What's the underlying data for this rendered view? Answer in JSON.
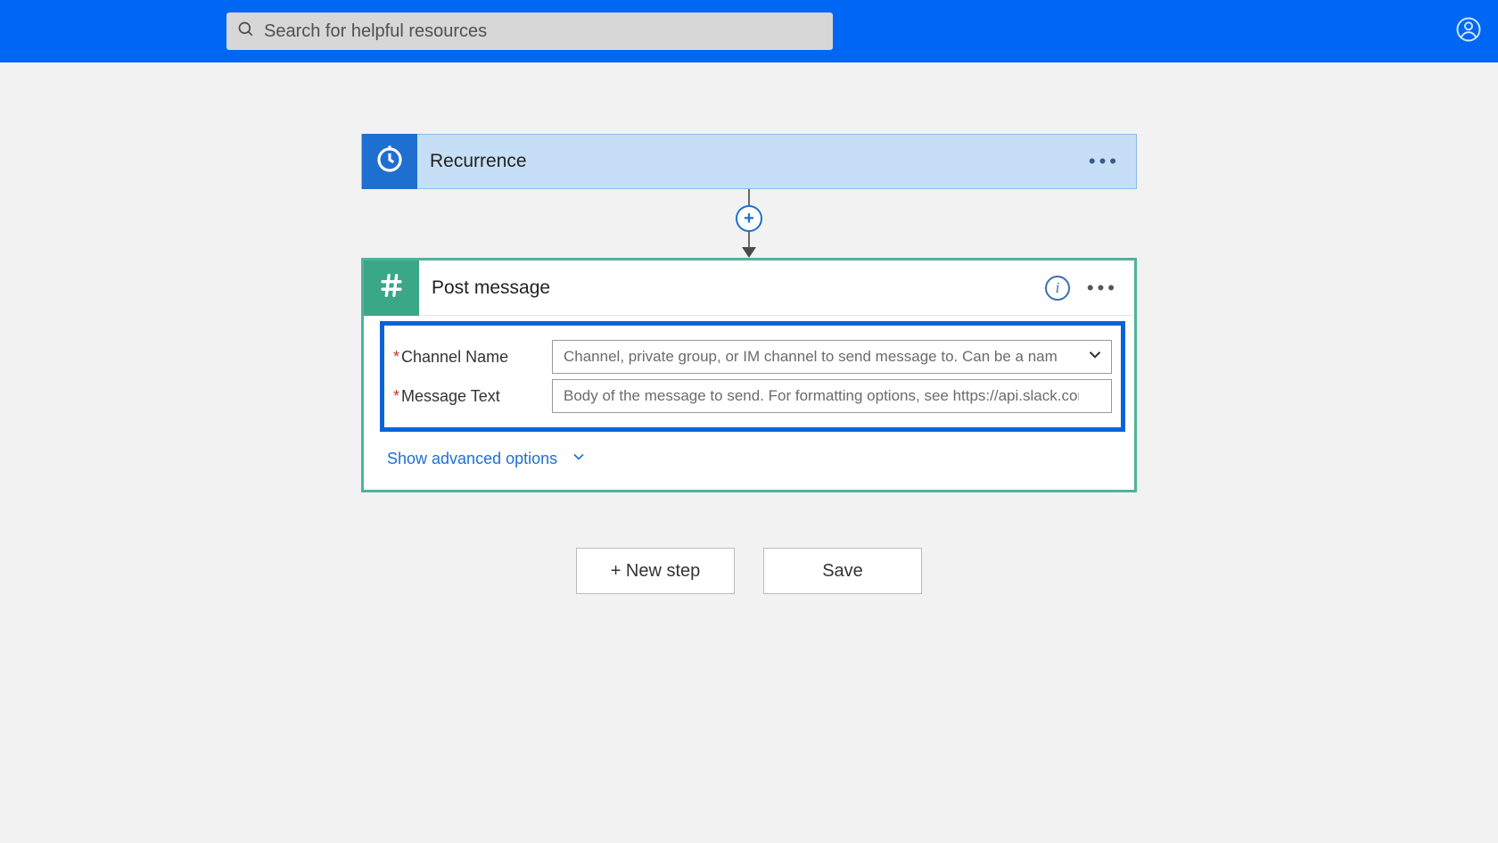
{
  "search": {
    "placeholder": "Search for helpful resources"
  },
  "cards": {
    "recurrence": {
      "title": "Recurrence"
    },
    "post": {
      "title": "Post message",
      "fields": {
        "channel": {
          "label": "Channel Name",
          "placeholder": "Channel, private group, or IM channel to send message to. Can be a nam"
        },
        "message": {
          "label": "Message Text",
          "placeholder": "Body of the message to send. For formatting options, see https://api.slack.com"
        }
      },
      "advanced_label": "Show advanced options"
    }
  },
  "buttons": {
    "new_step": "+ New step",
    "save": "Save"
  },
  "colors": {
    "topbar": "#0067f4",
    "recurrence_badge": "#1f6fd0",
    "post_border": "#4fb39a",
    "post_badge": "#3aa787",
    "highlight": "#0a63d6"
  }
}
